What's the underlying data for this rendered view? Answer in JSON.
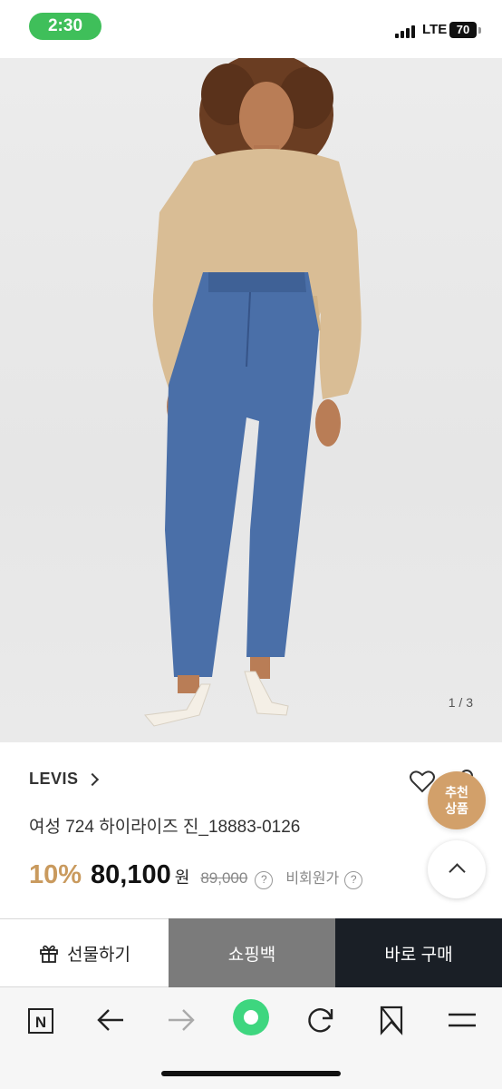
{
  "status_bar": {
    "time": "2:30",
    "network": "LTE",
    "battery": "70"
  },
  "gallery": {
    "page_indicator": "1 / 3"
  },
  "product": {
    "brand": "LEVIS",
    "name": "여성 724 하이라이즈 진_18883-0126",
    "discount": "10%",
    "price": "80,100",
    "currency": "원",
    "original_price": "89,000",
    "non_member_label": "비회원가",
    "help_glyph": "?"
  },
  "floating": {
    "recommend_line1": "추천",
    "recommend_line2": "상품"
  },
  "actions": {
    "gift": "선물하기",
    "cart": "쇼핑백",
    "buy": "바로 구매"
  },
  "browser": {
    "home_letter": "N"
  },
  "colors": {
    "status_green": "#3fbf5a",
    "discount_gold": "#c99a5e",
    "recommend_badge": "#d2a06a",
    "cart_gray": "#7b7b7b",
    "buy_dark": "#1a1f26",
    "nav_green": "#3ed67f"
  }
}
